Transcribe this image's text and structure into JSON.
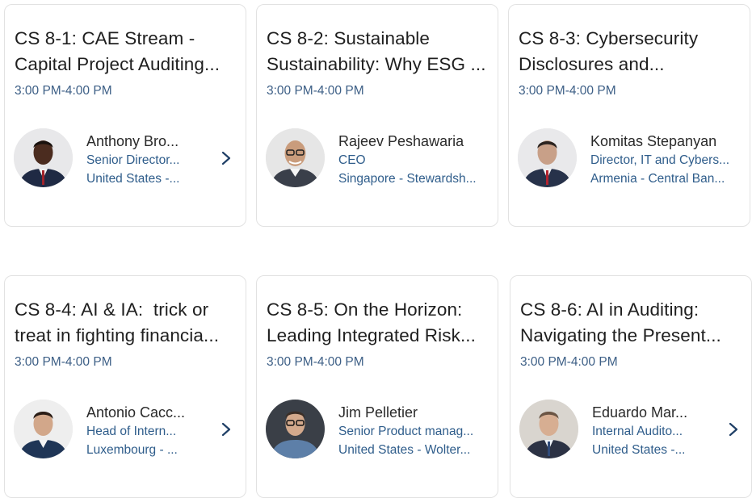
{
  "sessions": [
    {
      "title_line1": "CS 8-1: CAE Stream -",
      "title_line2": "Capital Project Auditing...",
      "time": "3:00 PM-4:00 PM",
      "speaker_name": "Anthony Bro...",
      "speaker_role": "Senior Director...",
      "speaker_org": "United States -...",
      "has_chevron": true
    },
    {
      "title_line1": "CS 8-2: Sustainable",
      "title_line2": "Sustainability: Why ESG ...",
      "time": "3:00 PM-4:00 PM",
      "speaker_name": "Rajeev Peshawaria",
      "speaker_role": "CEO",
      "speaker_org": "Singapore - Stewardsh...",
      "has_chevron": false
    },
    {
      "title_line1": "CS 8-3: Cybersecurity",
      "title_line2": "Disclosures and...",
      "time": "3:00 PM-4:00 PM",
      "speaker_name": "Komitas Stepanyan",
      "speaker_role": "Director, IT and Cybers...",
      "speaker_org": "Armenia - Central Ban...",
      "has_chevron": false
    },
    {
      "title_line1": "CS 8-4: AI & IA:  trick or",
      "title_line2": "treat in fighting financia...",
      "time": "3:00 PM-4:00 PM",
      "speaker_name": "Antonio Cacc...",
      "speaker_role": "Head of Intern...",
      "speaker_org": "Luxembourg - ...",
      "has_chevron": true
    },
    {
      "title_line1": "CS 8-5: On the Horizon:",
      "title_line2": "Leading Integrated Risk...",
      "time": "3:00 PM-4:00 PM",
      "speaker_name": "Jim Pelletier",
      "speaker_role": "Senior Product manag...",
      "speaker_org": "United States - Wolter...",
      "has_chevron": false
    },
    {
      "title_line1": "CS 8-6: AI in Auditing:",
      "title_line2": "Navigating the Present...",
      "time": "3:00 PM-4:00 PM",
      "speaker_name": "Eduardo Mar...",
      "speaker_role": "Internal Audito...",
      "speaker_org": "United States -...",
      "has_chevron": true
    }
  ],
  "colors": {
    "time_text": "#3d5f86",
    "speaker_detail_text": "#2f5d8b",
    "card_border": "#e2e2e2",
    "chevron": "#1f3f66"
  },
  "icons": {
    "chevron": "chevron-right-icon",
    "avatar": "speaker-photo"
  }
}
